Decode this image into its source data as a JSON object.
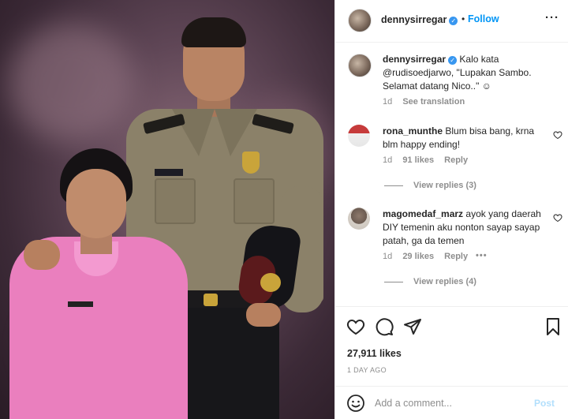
{
  "post": {
    "image": {
      "description_icon": "photo"
    },
    "author": {
      "username": "dennysirregar",
      "verified": true
    },
    "follow_label": "Follow",
    "separator": "•",
    "more_label": "···",
    "caption": {
      "username": "dennysirregar",
      "text": "Kalo kata @rudisoedjarwo, \"Lupakan Sambo. Selamat datang Nico..\" ☺",
      "age": "1d",
      "see_translation": "See translation"
    },
    "comments": [
      {
        "username": "rona_munthe",
        "text": "Blum bisa bang, krna blm happy ending!",
        "age": "1d",
        "likes": "91 likes",
        "reply": "Reply",
        "view_replies": "View replies (3)"
      },
      {
        "username": "magomedaf_marz",
        "text": "ayok yang daerah DIY temenin aku nonton sayap sayap patah, ga da temen",
        "age": "1d",
        "likes": "29 likes",
        "reply": "Reply",
        "more": "•••",
        "view_replies": "View replies (4)"
      }
    ],
    "actions": {
      "icons": [
        "heart-icon",
        "comment-icon",
        "share-icon",
        "bookmark-icon"
      ]
    },
    "like_count": "27,911 likes",
    "date": "1 DAY AGO",
    "comment_box": {
      "placeholder": "Add a comment...",
      "post_label": "Post",
      "emoji_icon": "smiley-icon"
    }
  }
}
